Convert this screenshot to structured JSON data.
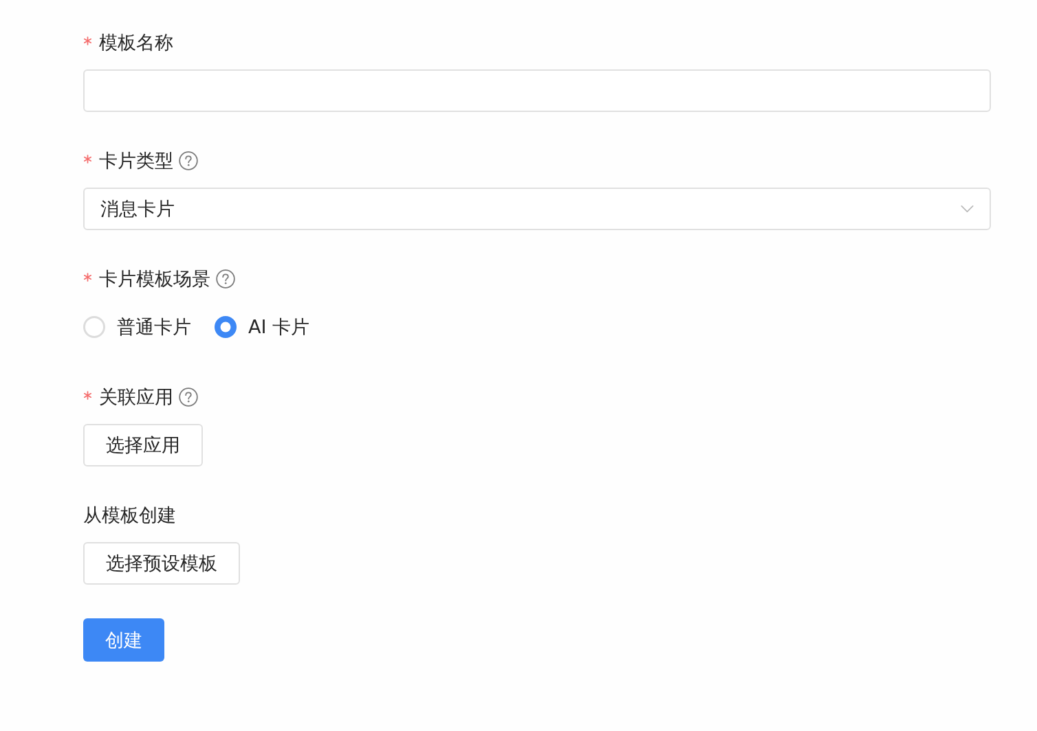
{
  "fields": [
    {
      "kind": "input",
      "label": "模板名称",
      "required": true,
      "help": false
    },
    {
      "kind": "select",
      "label": "卡片类型",
      "required": true,
      "help": true,
      "value": "消息卡片"
    },
    {
      "kind": "radio",
      "label": "卡片模板场景",
      "required": true,
      "help": true,
      "options": [
        {
          "label": "普通卡片",
          "selected": false
        },
        {
          "label": "AI 卡片",
          "selected": true
        }
      ]
    },
    {
      "kind": "button",
      "label": "关联应用",
      "required": true,
      "help": true,
      "button": "选择应用"
    },
    {
      "kind": "button",
      "label": "从模板创建",
      "required": false,
      "help": false,
      "button": "选择预设模板"
    }
  ],
  "submit": {
    "label": "创建"
  }
}
